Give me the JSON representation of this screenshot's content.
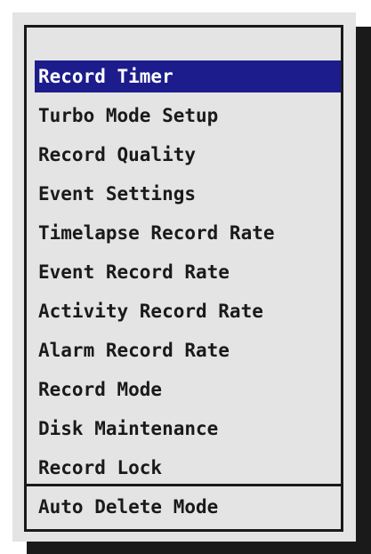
{
  "menu": {
    "items": [
      {
        "label": "Record Timer",
        "selected": true
      },
      {
        "label": "Turbo Mode Setup",
        "selected": false
      },
      {
        "label": "Record Quality",
        "selected": false
      },
      {
        "label": "Event Settings",
        "selected": false
      },
      {
        "label": "Timelapse Record Rate",
        "selected": false
      },
      {
        "label": "Event Record Rate",
        "selected": false
      },
      {
        "label": "Activity Record Rate",
        "selected": false
      },
      {
        "label": "Alarm Record Rate",
        "selected": false
      },
      {
        "label": "Record Mode",
        "selected": false
      },
      {
        "label": "Disk Maintenance",
        "selected": false
      },
      {
        "label": "Record Lock",
        "selected": false
      }
    ]
  },
  "footer": {
    "label": "Auto Delete Mode"
  },
  "colors": {
    "selection": "#1c1c8c",
    "panel": "#e4e4e4",
    "border": "#1a1a1a"
  }
}
